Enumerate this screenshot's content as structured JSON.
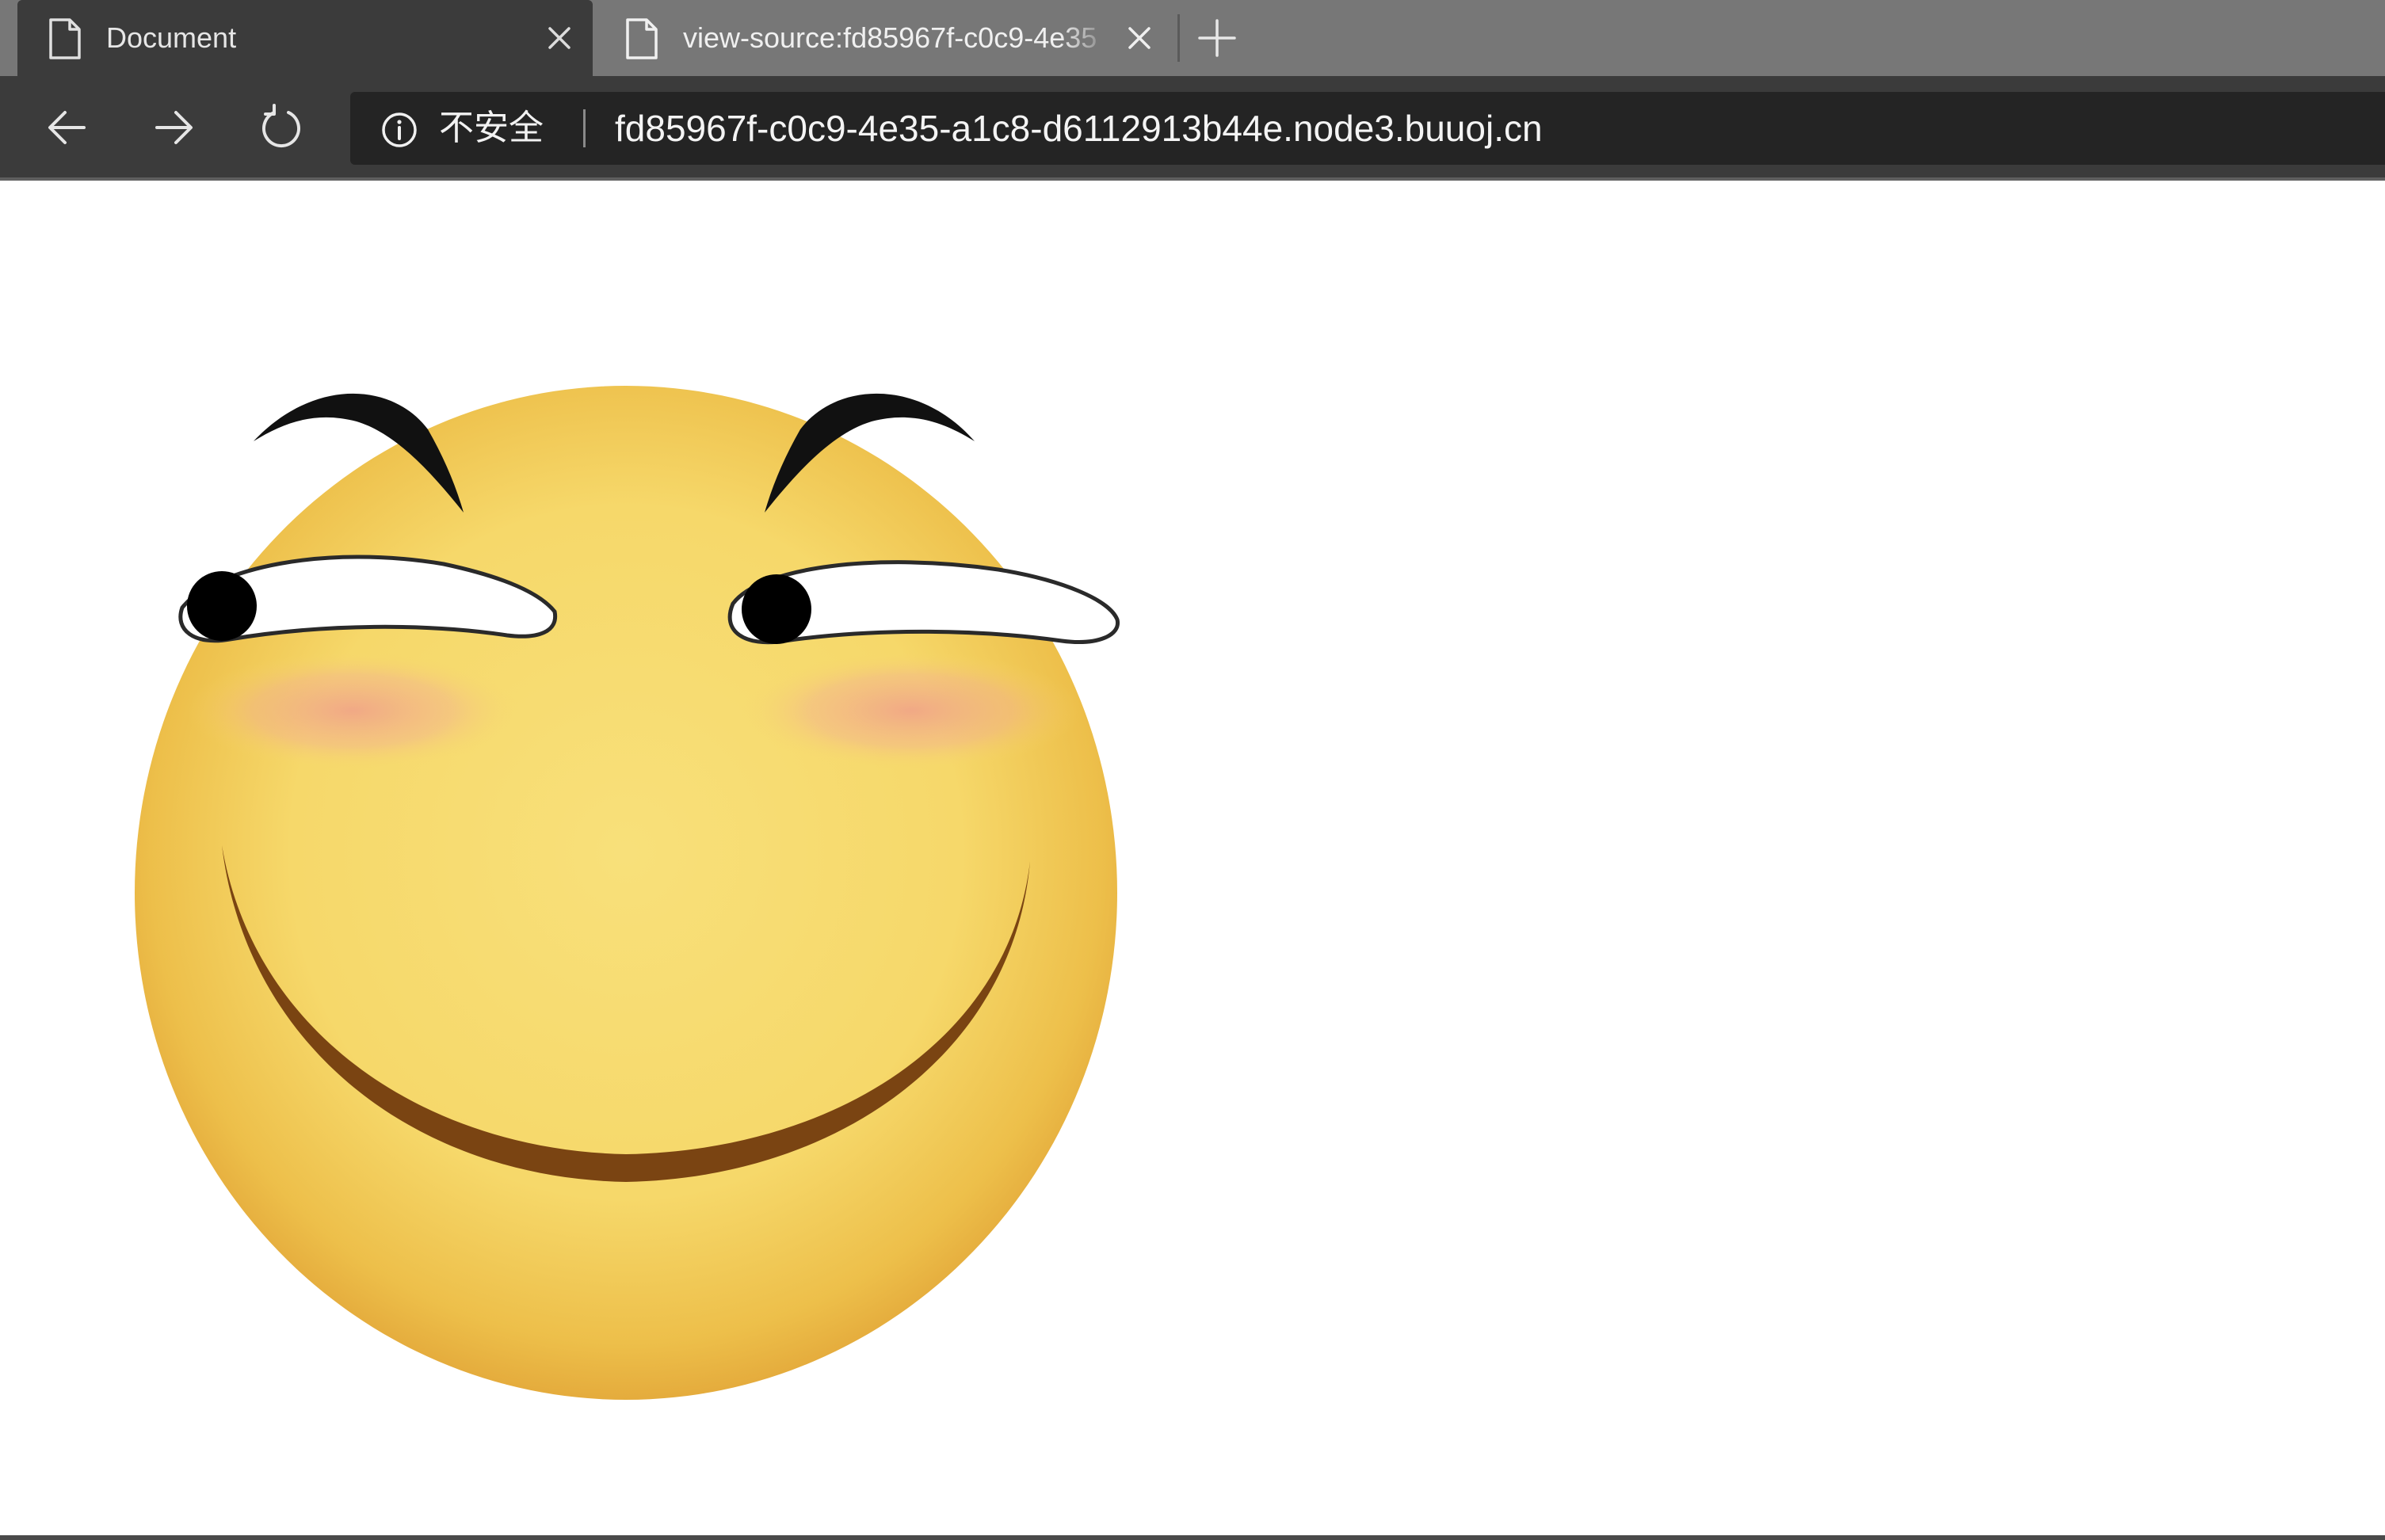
{
  "tabs": [
    {
      "title": "Document",
      "state": "active",
      "icon": "page-icon"
    },
    {
      "title": "view-source:fd85967f-c0c9-4e35",
      "state": "inactive",
      "icon": "page-icon"
    }
  ],
  "toolbar": {
    "security_label": "不安全",
    "url": "fd85967f-c0c9-4e35-a1c8-d6112913b44e.node3.buuoj.cn"
  },
  "content": {
    "image": "smiling-face-emoji"
  },
  "colors": {
    "tabstrip_bg": "#777777",
    "toolbar_bg": "#3b3b3b",
    "address_bg": "#242424",
    "face_yellow": "#f6d86a",
    "face_edge": "#e9b43c",
    "mouth_brown": "#7a4412"
  }
}
